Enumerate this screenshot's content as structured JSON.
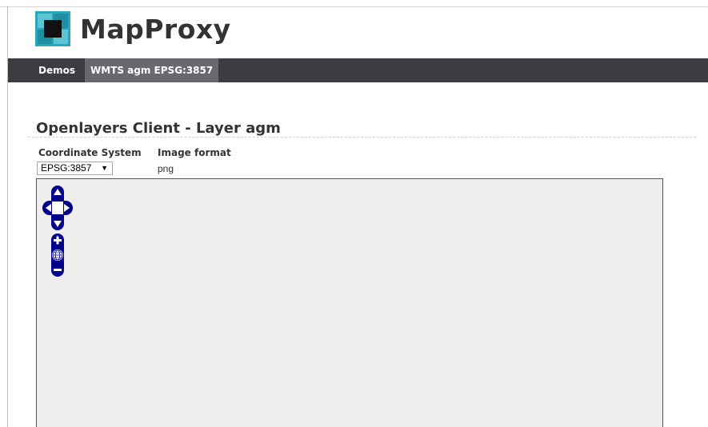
{
  "app": {
    "title": "MapProxy",
    "logo_icon": "mapproxy-logo-icon"
  },
  "nav": {
    "items": [
      {
        "label": "Demos"
      },
      {
        "label": "WMTS agm EPSG:3857"
      }
    ]
  },
  "main": {
    "heading": "Openlayers Client - Layer agm",
    "coordinate_system_label": "Coordinate System",
    "image_format_label": "Image format",
    "coordinate_system_value": "EPSG:3857",
    "image_format_value": "png"
  },
  "map": {
    "background": "#eeeeee",
    "controls": {
      "pan_icon": "pan-arrows-icon",
      "zoom_in_icon": "plus-icon",
      "zoom_world_icon": "globe-icon",
      "zoom_out_icon": "minus-icon"
    }
  },
  "colors": {
    "navbar": "#3d3c41",
    "nav_active": "#69686d",
    "logo_teal": "#2aa6bb",
    "control_blue": "#00008b"
  }
}
